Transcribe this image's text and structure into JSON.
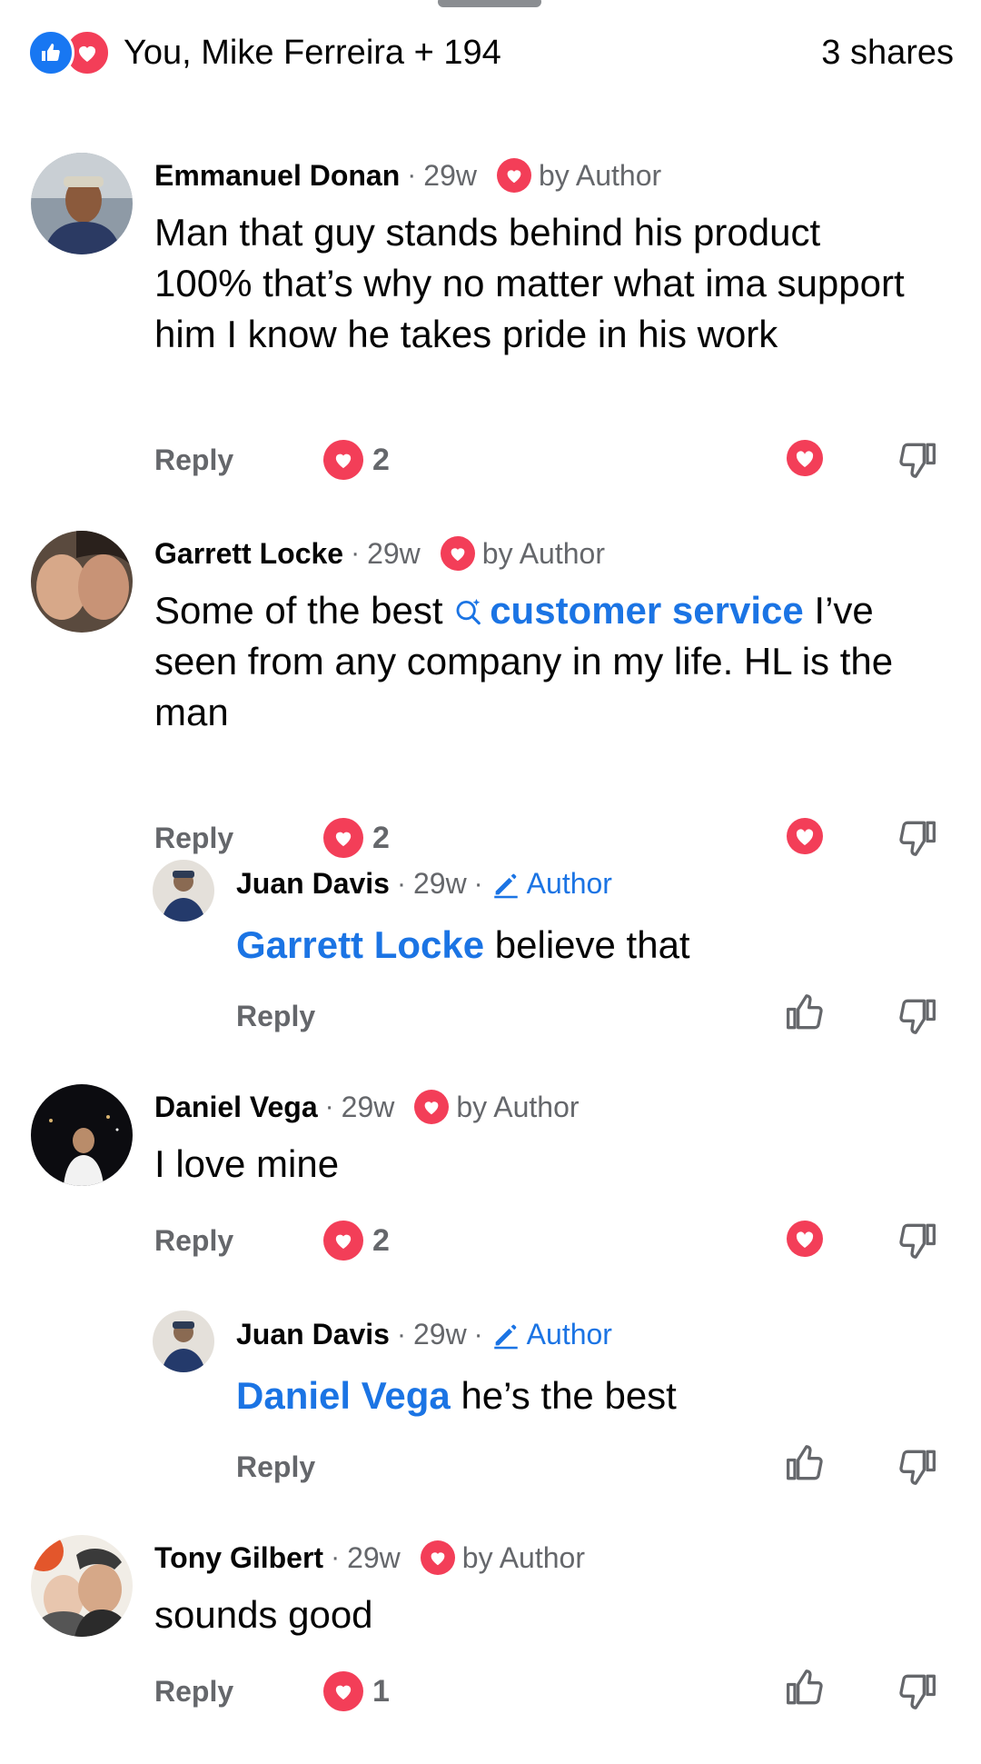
{
  "reactions_bar": {
    "names": "You, Mike Ferreira + 194",
    "shares": "3 shares"
  },
  "comments": [
    {
      "name": "Emmanuel Donan",
      "time": "29w",
      "badge": "by Author",
      "text": "Man that guy stands behind his product 100% that’s why no matter what ima support him I know he takes pride in his work",
      "reply": "Reply",
      "reaction_count": "2"
    },
    {
      "name": "Garrett Locke",
      "time": "29w",
      "badge": "by Author",
      "text_before": "Some of the best ",
      "link": "customer service",
      "text_after": " I’ve seen from any company in my life. HL is the man",
      "reply": "Reply",
      "reaction_count": "2"
    },
    {
      "name": "Juan Davis",
      "time": "29w",
      "badge": "Author",
      "mention": "Garrett Locke",
      "text": " believe that",
      "reply": "Reply"
    },
    {
      "name": "Daniel Vega",
      "time": "29w",
      "badge": "by Author",
      "text": "I love mine",
      "reply": "Reply",
      "reaction_count": "2"
    },
    {
      "name": "Juan Davis",
      "time": "29w",
      "badge": "Author",
      "mention": "Daniel Vega",
      "text": " he’s the best",
      "reply": "Reply"
    },
    {
      "name": "Tony Gilbert",
      "time": "29w",
      "badge": "by Author",
      "text": "sounds good",
      "reply": "Reply",
      "reaction_count": "1"
    }
  ],
  "colors": {
    "love": "#f33e58",
    "like": "#1877f2",
    "link": "#1b74e4",
    "muted": "#65676b"
  }
}
